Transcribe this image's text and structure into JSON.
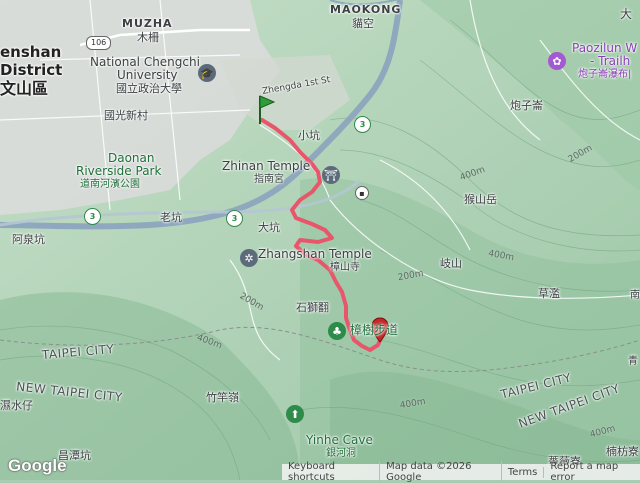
{
  "labels": {
    "muzha_en": "MUZHA",
    "muzha_zh": "木柵",
    "maokong_en": "MAOKONG",
    "maokong_zh": "貓空",
    "wenshan_en_1": "enshan",
    "wenshan_en_2": "District",
    "wenshan_zh": "文山區",
    "nccu_en_1": "National Chengchi",
    "nccu_en_2": "University",
    "nccu_zh": "國立政治大學",
    "guoguang": "國光新村",
    "daonan_1": "Daonan",
    "daonan_2": "Riverside Park",
    "daonan_zh": "道南河濱公園",
    "zhengda_st": "Zhengda 1st St",
    "xiaokeng": "小坑",
    "zhinan_temple": "Zhinan Temple",
    "zhinan_zh": "指南宮",
    "laokeng": "老坑",
    "aquankeng": "阿泉坑",
    "dakeng": "大坑",
    "zhangshan_temple": "Zhangshan Temple",
    "zhangshan_zh": "樟山寺",
    "shishiyi": "石獅翻",
    "trail": "樟樹步道",
    "houshan": "猴山岳",
    "qishan": "岐山",
    "caolan": "草濫",
    "paozizan": "炮子崙",
    "paozilun_1": "Paozilun W",
    "paozilun_2": "- Trailh",
    "paozilun_zh": "炮子崙瀑布|",
    "taipei_city_1": "TAIPEI CITY",
    "taipei_city_2": "TAIPEI CITY",
    "new_taipei_1": "NEW TAIPEI CITY",
    "new_taipei_2": "NEW TAIPEI CITY",
    "shuizai": "濕水仔",
    "zhugan": "竹竿嶺",
    "yinhe_cave": "Yinhe Cave",
    "yinhe_zh": "銀河洞",
    "tanken": "昌潭坑",
    "nanfang": "楠枋寮",
    "qiangwei": "薔薇寮",
    "da_corner": "大",
    "nan_corner": "南",
    "qing_corner": "青",
    "elev_400_1": "400m",
    "elev_400_2": "400m",
    "elev_400_3": "400m",
    "elev_200_1": "200m",
    "elev_200_2": "200m",
    "elev_200_3": "200m",
    "elev_400_4": "400m",
    "elev_400_5": "400m"
  },
  "shields": {
    "route_106": "106",
    "hw3_a": "3",
    "hw3_b": "3",
    "hw3_c": "3"
  },
  "footer": {
    "shortcuts": "Keyboard shortcuts",
    "map_data": "Map data ©2026 Google",
    "terms": "Terms",
    "report": "Report a map error"
  },
  "logo": "Google",
  "colors": {
    "route": "#e8566c",
    "start_marker": "#2e9e3a",
    "end_marker": "#c62828",
    "highway": "#8fa8bd",
    "urban": "#d9d9d9"
  }
}
